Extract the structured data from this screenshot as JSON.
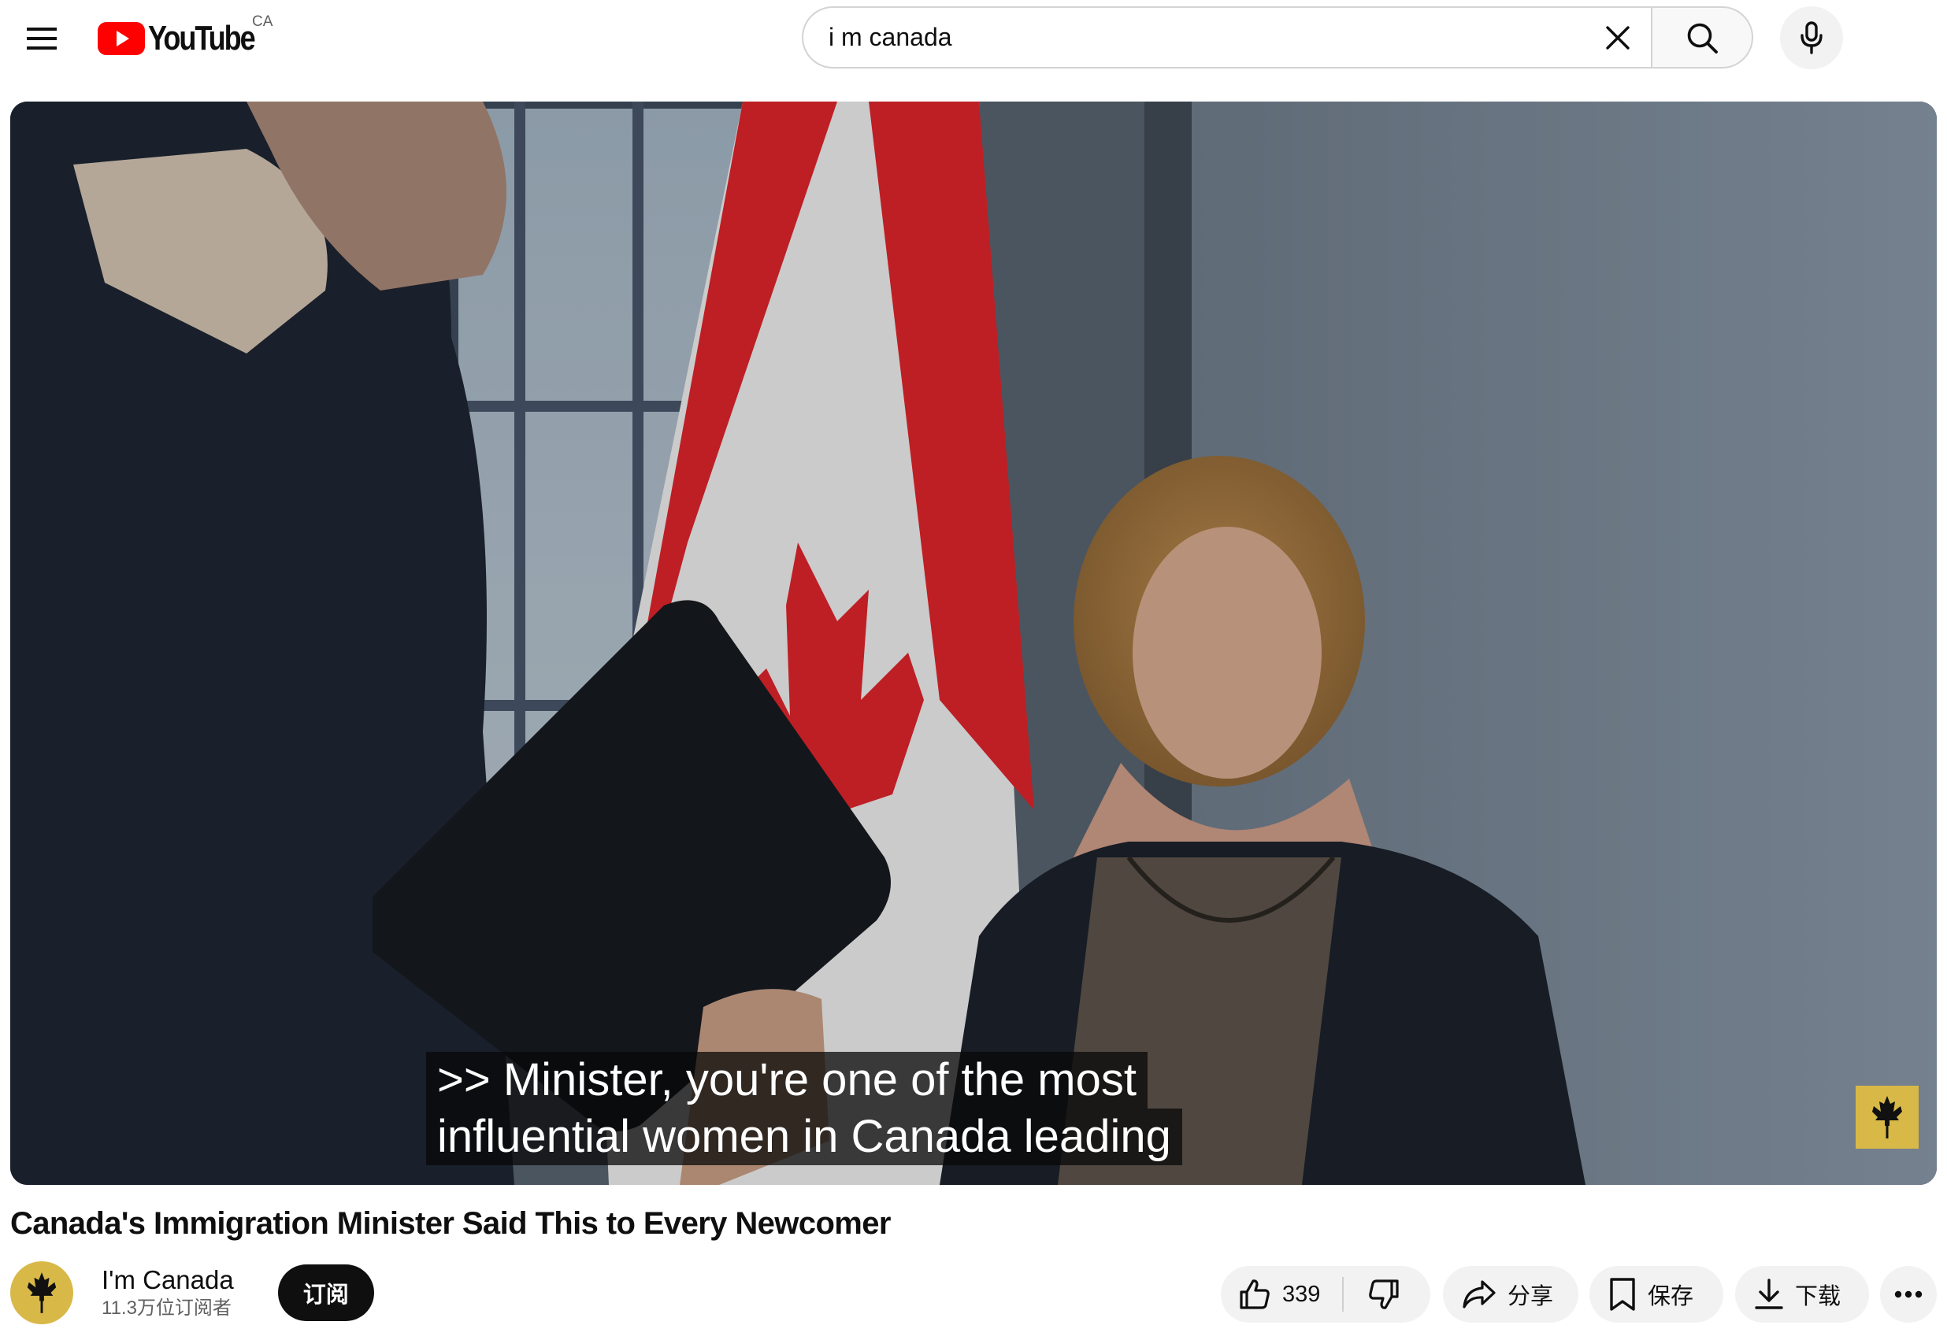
{
  "masthead": {
    "logo_text": "YouTube",
    "country_code": "CA",
    "search_value": "i m canada",
    "icons": {
      "menu": "hamburger-menu-icon",
      "logo": "youtube-play-icon",
      "clear": "close-icon",
      "search": "search-icon",
      "mic": "microphone-icon"
    }
  },
  "player": {
    "caption_line1": ">> Minister, you're one of the most",
    "caption_line2": "influential women in Canada leading",
    "channel_watermark_icon": "maple-leaf-icon"
  },
  "video": {
    "title": "Canada's Immigration Minister Said This to Every Newcomer"
  },
  "channel": {
    "name": "I'm Canada",
    "subscribers": "11.3万位订阅者",
    "subscribe_label": "订阅",
    "avatar_icon": "maple-leaf-icon"
  },
  "actions": {
    "like_count": "339",
    "share_label": "分享",
    "save_label": "保存",
    "download_label": "下载",
    "icons": {
      "like": "thumbs-up-icon",
      "dislike": "thumbs-down-icon",
      "share": "share-arrow-icon",
      "save": "bookmark-icon",
      "download": "download-icon",
      "more": "more-horizontal-icon"
    }
  },
  "colors": {
    "youtube_red": "#ff0000",
    "text_primary": "#0f0f0f",
    "text_secondary": "#606060",
    "pill_bg": "#f2f2f2",
    "channel_gold": "#d8b948"
  }
}
